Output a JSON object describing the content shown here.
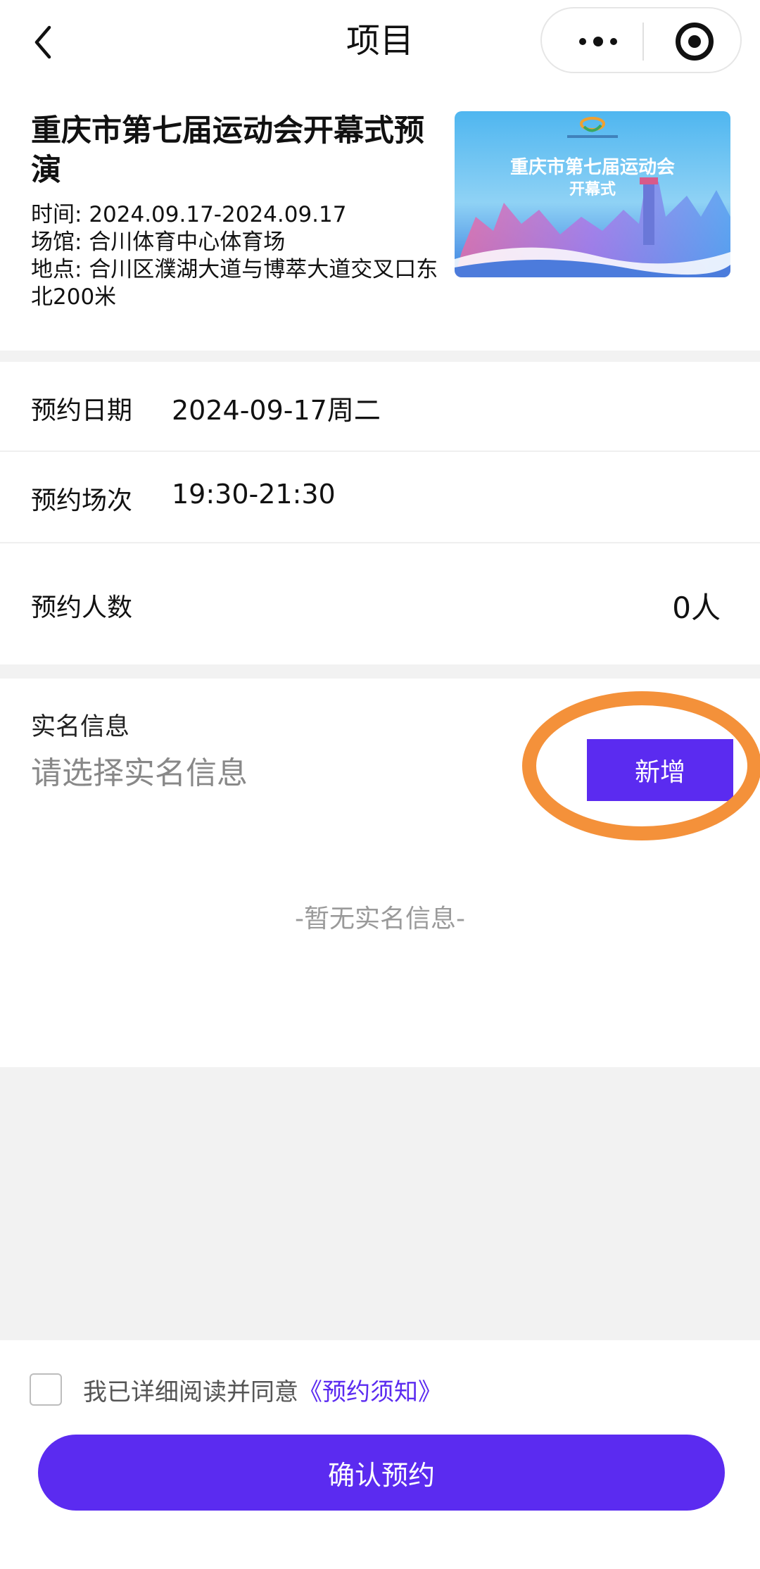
{
  "nav": {
    "title": "项目",
    "back_icon": "chevron-left-icon",
    "more_icon": "more-dots-icon",
    "close_icon": "target-icon"
  },
  "event": {
    "title": "重庆市第七届运动会开幕式预演",
    "time_label": "时间:",
    "time_value": "2024.09.17-2024.09.17",
    "venue_label": "场馆:",
    "venue_value": "合川体育中心体育场",
    "address_label": "地点:",
    "address_value": "合川区濮湖大道与博萃大道交叉口东北200米",
    "poster": {
      "title": "重庆市第七届运动会",
      "subtitle": "开幕式"
    }
  },
  "booking": {
    "date_label": "预约日期",
    "date_value": "2024-09-17周二",
    "session_label": "预约场次",
    "session_value": "19:30-21:30",
    "count_label": "预约人数",
    "count_value": "0人"
  },
  "realname": {
    "title": "实名信息",
    "hint": "请选择实名信息",
    "add_label": "新增",
    "empty_text": "-暂无实名信息-"
  },
  "footer": {
    "agree_text": "我已详细阅读并同意",
    "agree_link": "《预约须知》",
    "confirm_label": "确认预约"
  },
  "colors": {
    "accent": "#5b2bf0",
    "highlight": "#f4913a",
    "divider": "#f2f2f2"
  }
}
